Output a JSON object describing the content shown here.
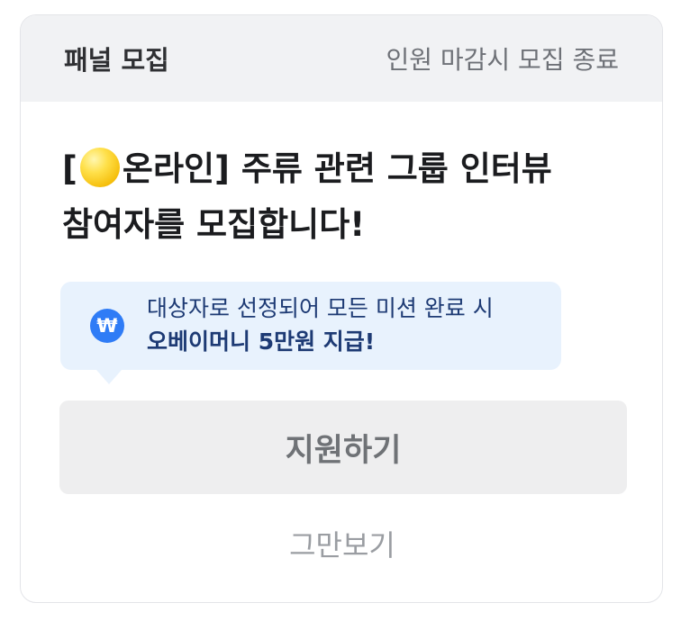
{
  "card": {
    "header": {
      "title": "패널 모집",
      "note": "인원 마감시 모집 종료"
    },
    "headline": {
      "bracket_open": "[",
      "coin_icon": "yellow-coin-icon",
      "text_after_coin": "온라인] 주류 관련 그룹 인터뷰",
      "line2": "참여자를 모집합니다!"
    },
    "reward": {
      "icon": "won-icon",
      "icon_glyph": "₩",
      "line1": "대상자로 선정되어 모든 미션 완료 시",
      "line2": "오베이머니 5만원 지급!"
    },
    "apply_button_label": "지원하기",
    "dismiss_label": "그만보기"
  },
  "colors": {
    "header_bg": "#f1f2f4",
    "bubble_bg": "#e8f2fd",
    "bubble_text": "#1d3a74",
    "won_icon_bg": "#2f7cf6",
    "button_bg": "#eeeeef",
    "coin": "#f5be0b"
  }
}
